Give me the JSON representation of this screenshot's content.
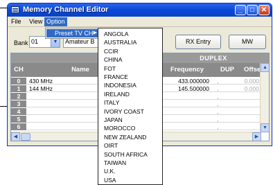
{
  "window": {
    "title": "Memory Channel Editor"
  },
  "menubar": {
    "file": "File",
    "view": "View",
    "option": "Option"
  },
  "submenu": {
    "preset_tv_ch": "Preset TV CH",
    "arrow": "▶"
  },
  "toolbar": {
    "bank_label": "Bank",
    "bank_value": "01",
    "bank_name": "Amateur B",
    "rx_entry": "RX Entry",
    "mw": "MW"
  },
  "grid": {
    "duplex_header": "DUPLEX",
    "columns": [
      "CH",
      "Name",
      "Frequency",
      "DUP",
      "Offset"
    ],
    "rows": [
      {
        "ch": "0",
        "name": "430 MHz",
        "frequency": "433.000000",
        "dup": ",",
        "offset": "0.000"
      },
      {
        "ch": "1",
        "name": "144 MHz",
        "frequency": "145.500000",
        "dup": ",",
        "offset": "0.000"
      },
      {
        "ch": "2",
        "name": "",
        "frequency": "",
        "dup": ",",
        "offset": ""
      },
      {
        "ch": "3",
        "name": "",
        "frequency": "",
        "dup": ",",
        "offset": ""
      },
      {
        "ch": "4",
        "name": "",
        "frequency": "",
        "dup": ",",
        "offset": ""
      },
      {
        "ch": "5",
        "name": "",
        "frequency": "",
        "dup": ",",
        "offset": ""
      },
      {
        "ch": "6",
        "name": "",
        "frequency": "",
        "dup": ",",
        "offset": ""
      }
    ]
  },
  "countries": [
    "ANGOLA",
    "AUSTRALIA",
    "CCIR",
    "CHINA",
    "FOT",
    "FRANCE",
    "INDONESIA",
    "IRELAND",
    "ITALY",
    "IVORY COAST",
    "JAPAN",
    "MOROCCO",
    "NEW ZEALAND",
    "OIRT",
    "SOUTH AFRICA",
    "TAIWAN",
    "U.K.",
    "USA"
  ],
  "colors": {
    "titlebar": "#0a48d8",
    "menu_highlight": "#316ac5",
    "grid_header": "#8a8a8a"
  }
}
